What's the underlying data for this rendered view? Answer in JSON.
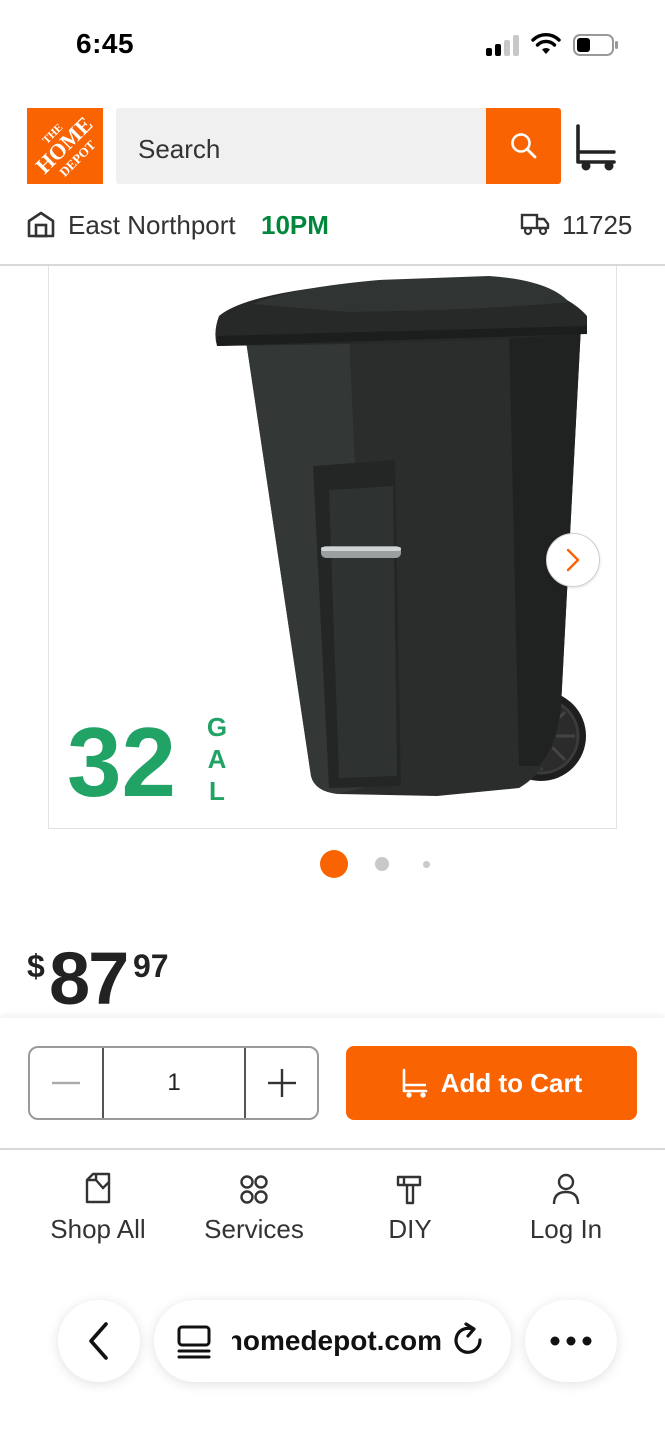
{
  "status_bar": {
    "time": "6:45"
  },
  "header": {
    "logo_text": "THE HOME DEPOT",
    "search_placeholder": "Search",
    "brand_color": "#f96302"
  },
  "store": {
    "name": "East Northport",
    "hours": "10PM",
    "zip": "11725",
    "hours_color": "#00873c"
  },
  "product": {
    "capacity_number": "32",
    "capacity_unit": [
      "G",
      "A",
      "L"
    ],
    "capacity_color": "#21a366",
    "image_count": 3,
    "active_image": 1,
    "price_symbol": "$",
    "price_dollars": "87",
    "price_cents": "97"
  },
  "cart_bar": {
    "quantity": "1",
    "add_to_cart_label": "Add to Cart"
  },
  "bottom_nav": [
    {
      "label": "Shop All",
      "icon": "shop-all-icon"
    },
    {
      "label": "Services",
      "icon": "services-icon"
    },
    {
      "label": "DIY",
      "icon": "diy-icon"
    },
    {
      "label": "Log In",
      "icon": "user-icon"
    }
  ],
  "browser": {
    "url": "homedepot.com"
  }
}
